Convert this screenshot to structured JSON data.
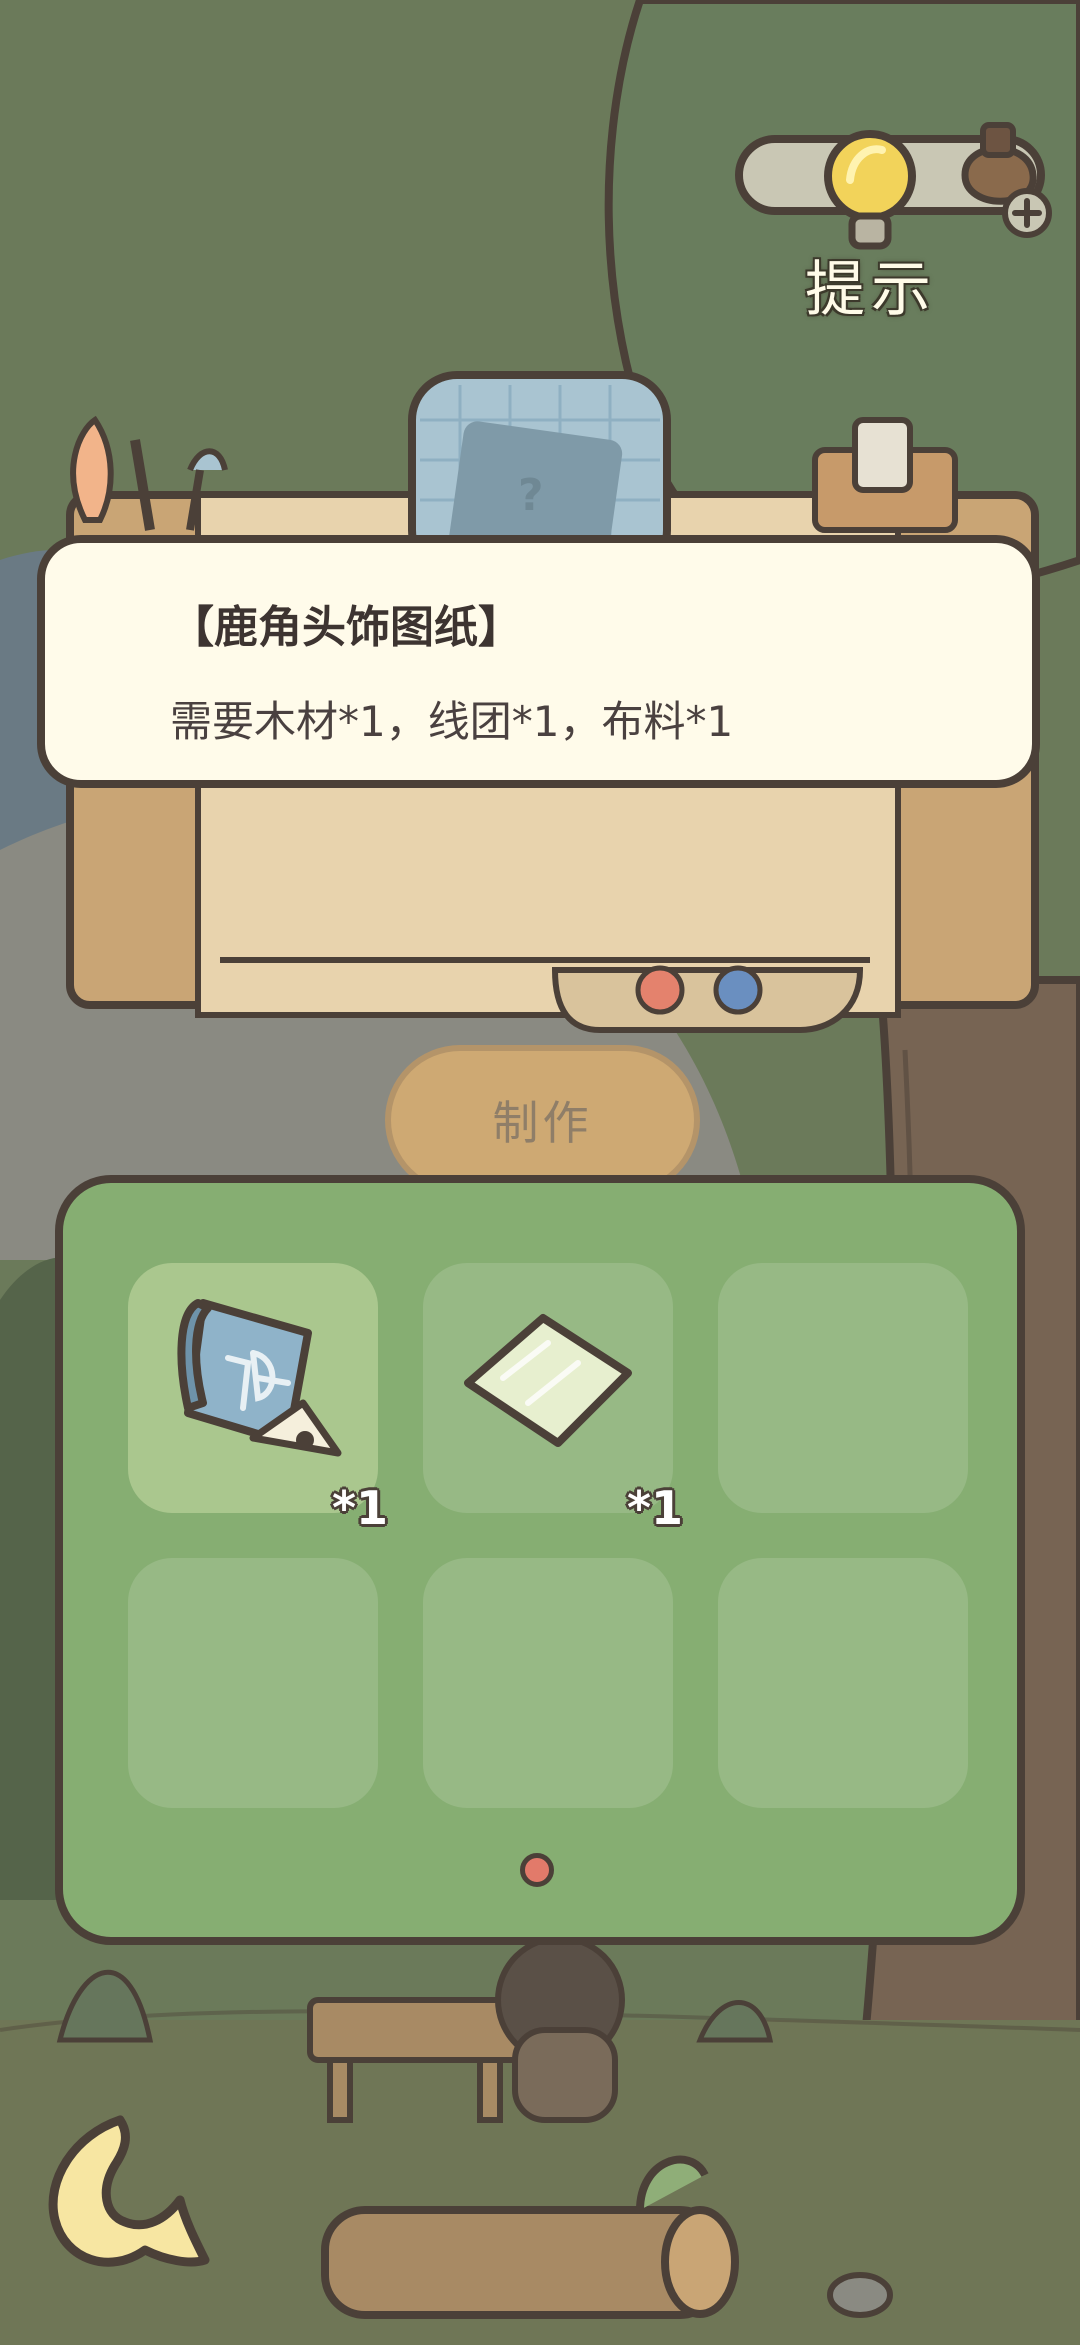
{
  "hint": {
    "label": "提示"
  },
  "recipe": {
    "title": "【鹿角头饰图纸】",
    "requirements": "需要木材*1，线团*1，布料*1"
  },
  "craft_button": {
    "label": "制作"
  },
  "inventory": {
    "slots": [
      {
        "icon": "blueprint-icon",
        "count": "*1",
        "selected": true
      },
      {
        "icon": "glass-pane-icon",
        "count": "*1",
        "selected": false
      },
      {
        "icon": "",
        "count": "",
        "selected": false
      },
      {
        "icon": "",
        "count": "",
        "selected": false
      },
      {
        "icon": "",
        "count": "",
        "selected": false
      },
      {
        "icon": "",
        "count": "",
        "selected": false
      }
    ],
    "page_indicator_color": "#e27a6a"
  },
  "colors": {
    "outline": "#4b4038",
    "panel_green": "#86ae72",
    "card_cream": "#fffbea",
    "craft_button": "#e1b270"
  }
}
